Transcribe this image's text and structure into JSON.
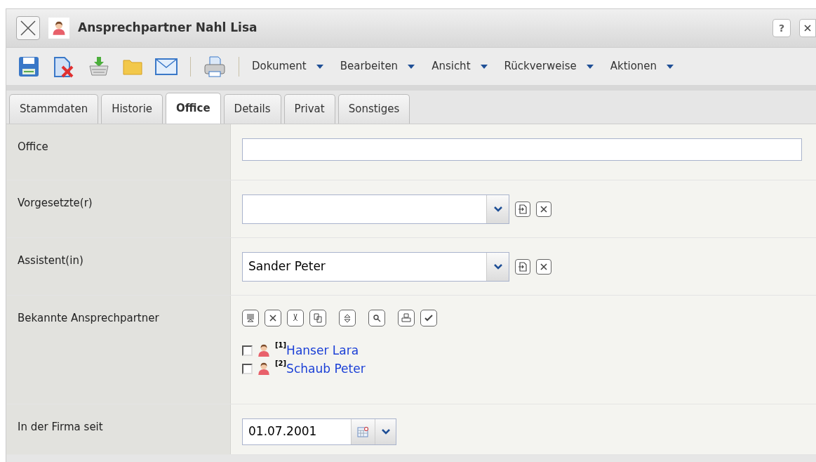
{
  "window": {
    "title": "Ansprechpartner Nahl Lisa",
    "help": "?"
  },
  "menus": [
    "Dokument",
    "Bearbeiten",
    "Ansicht",
    "Rückverweise",
    "Aktionen"
  ],
  "tabs": [
    {
      "label": "Stammdaten",
      "selected": false
    },
    {
      "label": "Historie",
      "selected": false
    },
    {
      "label": "Office",
      "selected": true
    },
    {
      "label": "Details",
      "selected": false
    },
    {
      "label": "Privat",
      "selected": false
    },
    {
      "label": "Sonstiges",
      "selected": false
    }
  ],
  "fields": [
    {
      "kind": "text",
      "label": "Office"
    },
    {
      "kind": "combo",
      "label": "Vorgesetzte(r)"
    },
    {
      "kind": "combo",
      "label": "Assistent(in)",
      "value": "Sander Peter"
    },
    {
      "kind": "list",
      "label": "Bekannte Ansprechpartner",
      "items": [
        {
          "marker": "[1]",
          "name": "Hanser Lara",
          "checked": false
        },
        {
          "marker": "[2]",
          "name": "Schaub Peter",
          "checked": false
        }
      ]
    },
    {
      "kind": "date",
      "label": "In der Firma seit",
      "value": "01.07.2001"
    }
  ]
}
